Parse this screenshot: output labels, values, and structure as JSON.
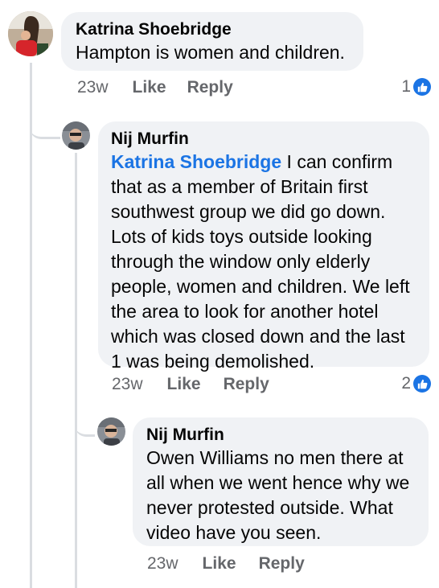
{
  "comments": [
    {
      "author": "Katrina Shoebridge",
      "text": "Hampton is women and children.",
      "time": "23w",
      "like_label": "Like",
      "reply_label": "Reply",
      "reaction_count": "1"
    },
    {
      "author": "Nij Murfin",
      "mention": "Katrina Shoebridge",
      "text": "I can confirm that as a member of Britain first southwest group we did go down. Lots of kids toys outside looking through the window only elderly people, women and children. We left the area to look for another hotel which was closed down and the last 1 was being demolished.",
      "time": "23w",
      "like_label": "Like",
      "reply_label": "Reply",
      "reaction_count": "2"
    },
    {
      "author": "Nij Murfin",
      "text": "Owen Williams no men there at all when we went hence why we never protested outside. What video have you seen.",
      "time": "23w",
      "like_label": "Like",
      "reply_label": "Reply"
    }
  ],
  "colors": {
    "bubble": "#f0f2f5",
    "accent": "#1b74e4",
    "muted_text": "#65676b",
    "thread_line": "#dadde1"
  },
  "icons": [
    "avatar-photo",
    "like-thumb-icon"
  ]
}
